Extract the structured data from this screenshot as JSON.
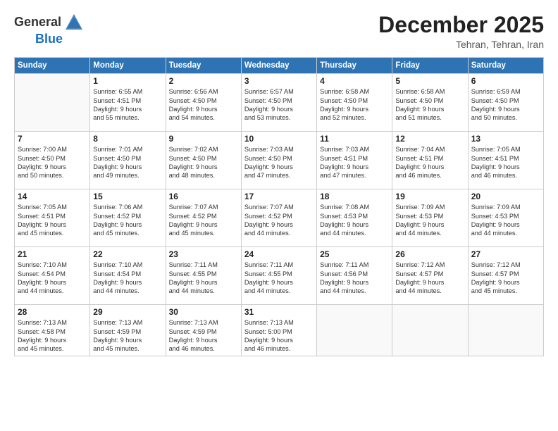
{
  "header": {
    "logo_general": "General",
    "logo_blue": "Blue",
    "month_year": "December 2025",
    "location": "Tehran, Tehran, Iran"
  },
  "calendar": {
    "days_of_week": [
      "Sunday",
      "Monday",
      "Tuesday",
      "Wednesday",
      "Thursday",
      "Friday",
      "Saturday"
    ],
    "weeks": [
      [
        {
          "day": "",
          "lines": []
        },
        {
          "day": "1",
          "lines": [
            "Sunrise: 6:55 AM",
            "Sunset: 4:51 PM",
            "Daylight: 9 hours",
            "and 55 minutes."
          ]
        },
        {
          "day": "2",
          "lines": [
            "Sunrise: 6:56 AM",
            "Sunset: 4:50 PM",
            "Daylight: 9 hours",
            "and 54 minutes."
          ]
        },
        {
          "day": "3",
          "lines": [
            "Sunrise: 6:57 AM",
            "Sunset: 4:50 PM",
            "Daylight: 9 hours",
            "and 53 minutes."
          ]
        },
        {
          "day": "4",
          "lines": [
            "Sunrise: 6:58 AM",
            "Sunset: 4:50 PM",
            "Daylight: 9 hours",
            "and 52 minutes."
          ]
        },
        {
          "day": "5",
          "lines": [
            "Sunrise: 6:58 AM",
            "Sunset: 4:50 PM",
            "Daylight: 9 hours",
            "and 51 minutes."
          ]
        },
        {
          "day": "6",
          "lines": [
            "Sunrise: 6:59 AM",
            "Sunset: 4:50 PM",
            "Daylight: 9 hours",
            "and 50 minutes."
          ]
        }
      ],
      [
        {
          "day": "7",
          "lines": [
            "Sunrise: 7:00 AM",
            "Sunset: 4:50 PM",
            "Daylight: 9 hours",
            "and 50 minutes."
          ]
        },
        {
          "day": "8",
          "lines": [
            "Sunrise: 7:01 AM",
            "Sunset: 4:50 PM",
            "Daylight: 9 hours",
            "and 49 minutes."
          ]
        },
        {
          "day": "9",
          "lines": [
            "Sunrise: 7:02 AM",
            "Sunset: 4:50 PM",
            "Daylight: 9 hours",
            "and 48 minutes."
          ]
        },
        {
          "day": "10",
          "lines": [
            "Sunrise: 7:03 AM",
            "Sunset: 4:50 PM",
            "Daylight: 9 hours",
            "and 47 minutes."
          ]
        },
        {
          "day": "11",
          "lines": [
            "Sunrise: 7:03 AM",
            "Sunset: 4:51 PM",
            "Daylight: 9 hours",
            "and 47 minutes."
          ]
        },
        {
          "day": "12",
          "lines": [
            "Sunrise: 7:04 AM",
            "Sunset: 4:51 PM",
            "Daylight: 9 hours",
            "and 46 minutes."
          ]
        },
        {
          "day": "13",
          "lines": [
            "Sunrise: 7:05 AM",
            "Sunset: 4:51 PM",
            "Daylight: 9 hours",
            "and 46 minutes."
          ]
        }
      ],
      [
        {
          "day": "14",
          "lines": [
            "Sunrise: 7:05 AM",
            "Sunset: 4:51 PM",
            "Daylight: 9 hours",
            "and 45 minutes."
          ]
        },
        {
          "day": "15",
          "lines": [
            "Sunrise: 7:06 AM",
            "Sunset: 4:52 PM",
            "Daylight: 9 hours",
            "and 45 minutes."
          ]
        },
        {
          "day": "16",
          "lines": [
            "Sunrise: 7:07 AM",
            "Sunset: 4:52 PM",
            "Daylight: 9 hours",
            "and 45 minutes."
          ]
        },
        {
          "day": "17",
          "lines": [
            "Sunrise: 7:07 AM",
            "Sunset: 4:52 PM",
            "Daylight: 9 hours",
            "and 44 minutes."
          ]
        },
        {
          "day": "18",
          "lines": [
            "Sunrise: 7:08 AM",
            "Sunset: 4:53 PM",
            "Daylight: 9 hours",
            "and 44 minutes."
          ]
        },
        {
          "day": "19",
          "lines": [
            "Sunrise: 7:09 AM",
            "Sunset: 4:53 PM",
            "Daylight: 9 hours",
            "and 44 minutes."
          ]
        },
        {
          "day": "20",
          "lines": [
            "Sunrise: 7:09 AM",
            "Sunset: 4:53 PM",
            "Daylight: 9 hours",
            "and 44 minutes."
          ]
        }
      ],
      [
        {
          "day": "21",
          "lines": [
            "Sunrise: 7:10 AM",
            "Sunset: 4:54 PM",
            "Daylight: 9 hours",
            "and 44 minutes."
          ]
        },
        {
          "day": "22",
          "lines": [
            "Sunrise: 7:10 AM",
            "Sunset: 4:54 PM",
            "Daylight: 9 hours",
            "and 44 minutes."
          ]
        },
        {
          "day": "23",
          "lines": [
            "Sunrise: 7:11 AM",
            "Sunset: 4:55 PM",
            "Daylight: 9 hours",
            "and 44 minutes."
          ]
        },
        {
          "day": "24",
          "lines": [
            "Sunrise: 7:11 AM",
            "Sunset: 4:55 PM",
            "Daylight: 9 hours",
            "and 44 minutes."
          ]
        },
        {
          "day": "25",
          "lines": [
            "Sunrise: 7:11 AM",
            "Sunset: 4:56 PM",
            "Daylight: 9 hours",
            "and 44 minutes."
          ]
        },
        {
          "day": "26",
          "lines": [
            "Sunrise: 7:12 AM",
            "Sunset: 4:57 PM",
            "Daylight: 9 hours",
            "and 44 minutes."
          ]
        },
        {
          "day": "27",
          "lines": [
            "Sunrise: 7:12 AM",
            "Sunset: 4:57 PM",
            "Daylight: 9 hours",
            "and 45 minutes."
          ]
        }
      ],
      [
        {
          "day": "28",
          "lines": [
            "Sunrise: 7:13 AM",
            "Sunset: 4:58 PM",
            "Daylight: 9 hours",
            "and 45 minutes."
          ]
        },
        {
          "day": "29",
          "lines": [
            "Sunrise: 7:13 AM",
            "Sunset: 4:59 PM",
            "Daylight: 9 hours",
            "and 45 minutes."
          ]
        },
        {
          "day": "30",
          "lines": [
            "Sunrise: 7:13 AM",
            "Sunset: 4:59 PM",
            "Daylight: 9 hours",
            "and 46 minutes."
          ]
        },
        {
          "day": "31",
          "lines": [
            "Sunrise: 7:13 AM",
            "Sunset: 5:00 PM",
            "Daylight: 9 hours",
            "and 46 minutes."
          ]
        },
        {
          "day": "",
          "lines": []
        },
        {
          "day": "",
          "lines": []
        },
        {
          "day": "",
          "lines": []
        }
      ]
    ]
  }
}
